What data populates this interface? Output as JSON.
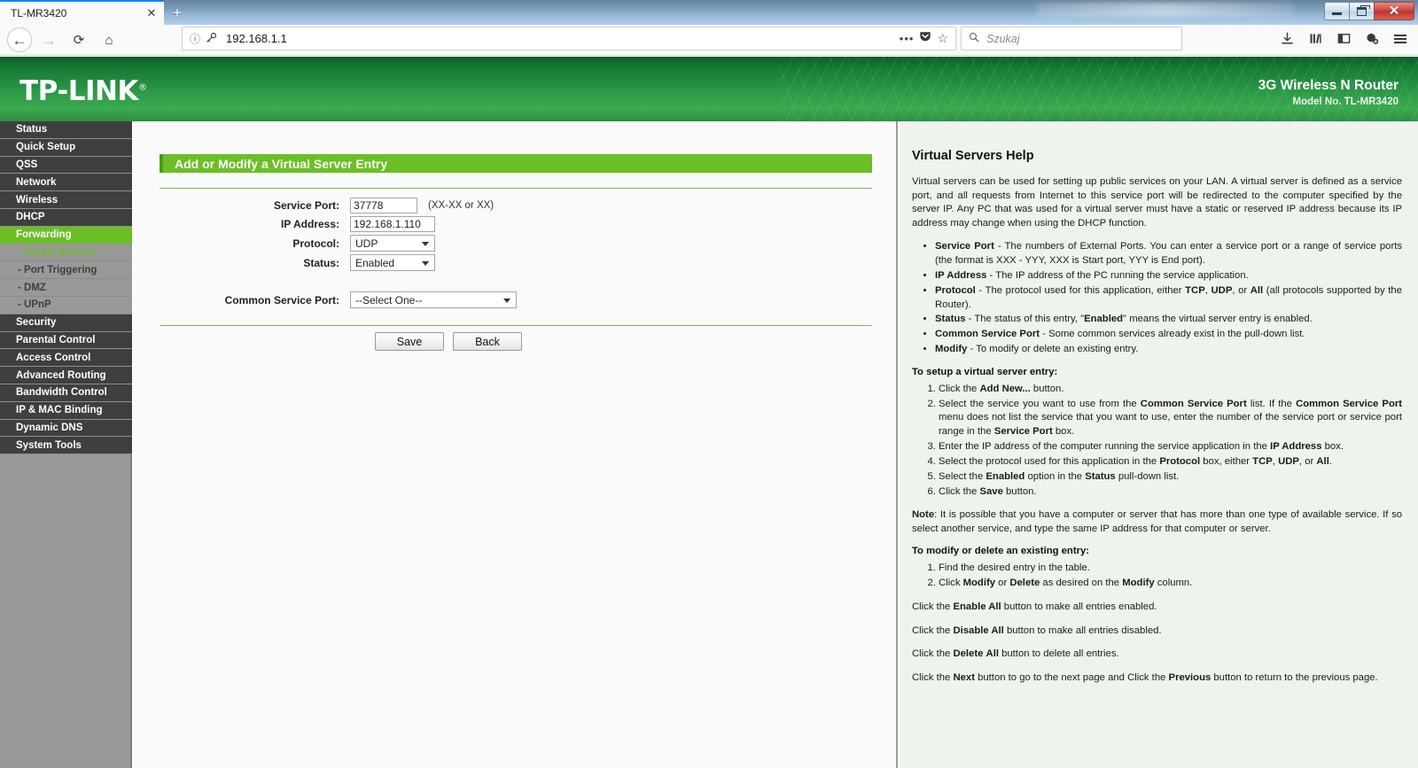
{
  "window": {
    "minimize_label": "Minimize",
    "maximize_label": "Maximize",
    "close_label": "✕"
  },
  "browser": {
    "tab_title": "TL-MR3420",
    "tab_close": "✕",
    "new_tab": "+",
    "back_icon": "←",
    "forward_icon": "→",
    "reload_icon": "⟳",
    "home_icon": "⌂",
    "url_identity_icon": "ⓘ",
    "url_key_icon": "🔑",
    "url_value": "192.168.1.1",
    "url_overflow": "•••",
    "pocket_icon": "🛡",
    "star_icon": "☆",
    "search_icon": "🔍",
    "search_placeholder": "Szukaj",
    "downloads_icon": "⤓",
    "library_icon": "|||\\",
    "sidebar_icon": "▯",
    "account_icon": "◕",
    "menu_icon": "hamburger"
  },
  "router_header": {
    "brand": "TP-LINK",
    "brand_trademark": "®",
    "product": "3G Wireless N Router",
    "model": "Model No. TL-MR3420"
  },
  "sidebar": {
    "items": [
      {
        "label": "Status",
        "type": "top",
        "state": "normal"
      },
      {
        "label": "Quick Setup",
        "type": "top",
        "state": "normal"
      },
      {
        "label": "QSS",
        "type": "top",
        "state": "normal"
      },
      {
        "label": "Network",
        "type": "top",
        "state": "normal"
      },
      {
        "label": "Wireless",
        "type": "top",
        "state": "normal"
      },
      {
        "label": "DHCP",
        "type": "top",
        "state": "normal"
      },
      {
        "label": "Forwarding",
        "type": "top",
        "state": "active"
      },
      {
        "label": "- Virtual Servers",
        "type": "sub",
        "state": "selected"
      },
      {
        "label": "- Port Triggering",
        "type": "sub",
        "state": "normal"
      },
      {
        "label": "- DMZ",
        "type": "sub",
        "state": "normal"
      },
      {
        "label": "- UPnP",
        "type": "sub",
        "state": "normal"
      },
      {
        "label": "Security",
        "type": "top",
        "state": "normal"
      },
      {
        "label": "Parental Control",
        "type": "top",
        "state": "normal"
      },
      {
        "label": "Access Control",
        "type": "top",
        "state": "normal"
      },
      {
        "label": "Advanced Routing",
        "type": "top",
        "state": "normal"
      },
      {
        "label": "Bandwidth Control",
        "type": "top",
        "state": "normal"
      },
      {
        "label": "IP & MAC Binding",
        "type": "top",
        "state": "normal"
      },
      {
        "label": "Dynamic DNS",
        "type": "top",
        "state": "normal"
      },
      {
        "label": "System Tools",
        "type": "top",
        "state": "normal"
      }
    ]
  },
  "main": {
    "panel_title": "Add or Modify a Virtual Server Entry",
    "fields": {
      "service_port_label": "Service Port:",
      "service_port_value": "37778",
      "service_port_hint": "(XX-XX or XX)",
      "ip_address_label": "IP Address:",
      "ip_address_value": "192.168.1.110",
      "protocol_label": "Protocol:",
      "protocol_value": "UDP",
      "status_label": "Status:",
      "status_value": "Enabled",
      "common_service_port_label": "Common Service Port:",
      "common_service_port_value": "--Select One--"
    },
    "buttons": {
      "save": "Save",
      "back": "Back"
    }
  },
  "help": {
    "title": "Virtual Servers Help",
    "intro": "Virtual servers can be used for setting up public services on your LAN. A virtual server is defined as a service port, and all requests from Internet to this service port will be redirected to the computer specified by the server IP. Any PC that was used for a virtual server must have a static or reserved IP address because its IP address may change when using the DHCP function.",
    "definitions": [
      {
        "term": "Service Port",
        "rest": " - The numbers of External Ports. You can enter a service port or a range of service ports (the format is XXX - YYY, XXX is Start port, YYY is End port)."
      },
      {
        "term": "IP Address",
        "rest": " - The IP address of the PC running the service application."
      },
      {
        "term": "Protocol",
        "rest": " - The protocol used for this application, either TCP, UDP, or All (all protocols supported by the Router)."
      },
      {
        "term": "Status",
        "rest": " - The status of this entry, \"Enabled\" means the virtual server entry is enabled."
      },
      {
        "term": "Common Service Port",
        "rest": " - Some common services already exist in the pull-down list."
      },
      {
        "term": "Modify",
        "rest": " - To modify or delete an existing entry."
      }
    ],
    "setup_heading": "To setup a virtual server entry:",
    "setup_steps": [
      "Click the Add New... button.",
      "Select the service you want to use from the Common Service Port list. If the Common Service Port menu does not list the service that you want to use, enter the number of the service port or service port range in the Service Port box.",
      "Enter the IP address of the computer running the service application in the IP Address box.",
      "Select the protocol used for this application in the Protocol box, either TCP, UDP, or All.",
      "Select the Enabled option in the Status pull-down list.",
      "Click the Save button."
    ],
    "note_term": "Note",
    "note_rest": ": It is possible that you have a computer or server that has more than one type of available service. If so select another service, and type the same IP address for that computer or server.",
    "modify_heading": "To modify or delete an existing entry:",
    "modify_steps": [
      "Find the desired entry in the table.",
      "Click Modify or Delete as desired on the Modify column."
    ],
    "tips": [
      "Click the Enable All button to make all entries enabled.",
      "Click the Disable All button to make all entries disabled.",
      "Click the Delete All button to delete all entries.",
      "Click the Next button to go to the next page and Click the Previous button to return to the previous page."
    ]
  },
  "colors": {
    "brand_green": "#6cbe26",
    "header_green": "#2b9a47",
    "sidebar_gray": "#999999",
    "menu_dark": "#3f3f3f",
    "help_bg": "#eef4ec"
  }
}
